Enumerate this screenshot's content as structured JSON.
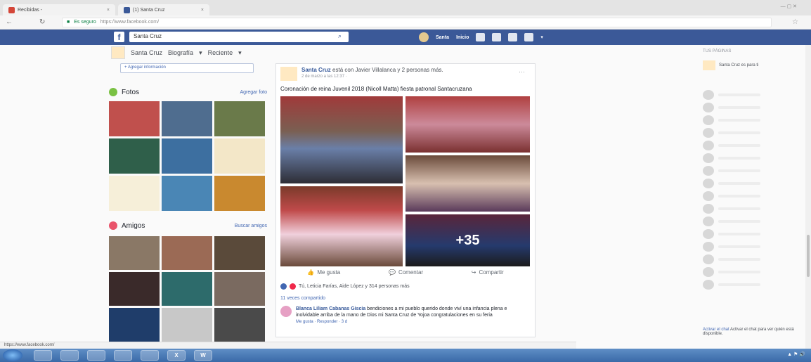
{
  "browser": {
    "tabs": [
      {
        "title": "Recibidas - ",
        "color": "#d44638"
      },
      {
        "title": "(1) Santa Cruz",
        "color": "#3b5998"
      }
    ],
    "address": {
      "secure_label": "Es seguro",
      "url": "https://www.facebook.com/"
    },
    "status_url": "https://www.facebook.com/"
  },
  "facebook": {
    "logo": "f",
    "search_value": "Santa Cruz",
    "nav_user": "Santa",
    "nav_home": "Inicio"
  },
  "profile_nav": {
    "name": "Santa Cruz",
    "items": [
      "Biografía",
      "Reciente"
    ]
  },
  "left": {
    "intro_link": "+ Agregar información",
    "photos_title": "Fotos",
    "photos_action": "Agregar foto",
    "friends_title": "Amigos",
    "friends_action": "Buscar amigos",
    "photos": [
      {
        "bg": "#c0504d"
      },
      {
        "bg": "#4f6d8f"
      },
      {
        "bg": "#6a7a4a"
      },
      {
        "bg": "#2f5f4a"
      },
      {
        "bg": "#3d6fa0"
      },
      {
        "bg": "#f3e7c8"
      },
      {
        "bg": "#f6efd9"
      },
      {
        "bg": "#4a86b5"
      },
      {
        "bg": "#c9892f"
      }
    ],
    "friends": [
      {
        "bg": "#8a7866"
      },
      {
        "bg": "#9b6a55"
      },
      {
        "bg": "#5a4a3a"
      },
      {
        "bg": "#3a2a2a"
      },
      {
        "bg": "#2d6b6b"
      },
      {
        "bg": "#7a6a60"
      },
      {
        "bg": "#1f3d6a"
      },
      {
        "bg": "#c8c8c8"
      },
      {
        "bg": "#4a4a4a"
      }
    ]
  },
  "post": {
    "author": "Santa Cruz",
    "author_rest": "está con Javier Villalanca y 2 personas más.",
    "time": "2 de marzo a las 12:37 ·",
    "more": "···",
    "text": "Coronación de reina Juvenil 2018 (Nicoll Matta) fiesta patronal Santacruzana",
    "more_photos": "+35",
    "actions": {
      "like": "Me gusta",
      "comment": "Comentar",
      "share": "Compartir"
    },
    "reactions": "Tú, Leticia Farías, Aide López y 314 personas más",
    "views": "11 veces compartido",
    "comment": {
      "author": "Blanca Liliam Cabanas Giscia",
      "text": "bendiciones a mi pueblo querido donde viví una infancia plena e inolvidable arriba de la mano de Dios mi Santa Cruz de Yojoa congratulaciones en su feria",
      "meta": "Me gusta · Responder · 3 d"
    }
  },
  "right": {
    "heading": "TUS PÁGINAS",
    "page": "Santa Cruz es para ti",
    "chat_footer": "Activar el chat para ver quién está disponible.",
    "chat_link": "Activar el chat"
  },
  "taskbar": {
    "apps": [
      "",
      "",
      "",
      "",
      "",
      "X",
      "W"
    ]
  }
}
